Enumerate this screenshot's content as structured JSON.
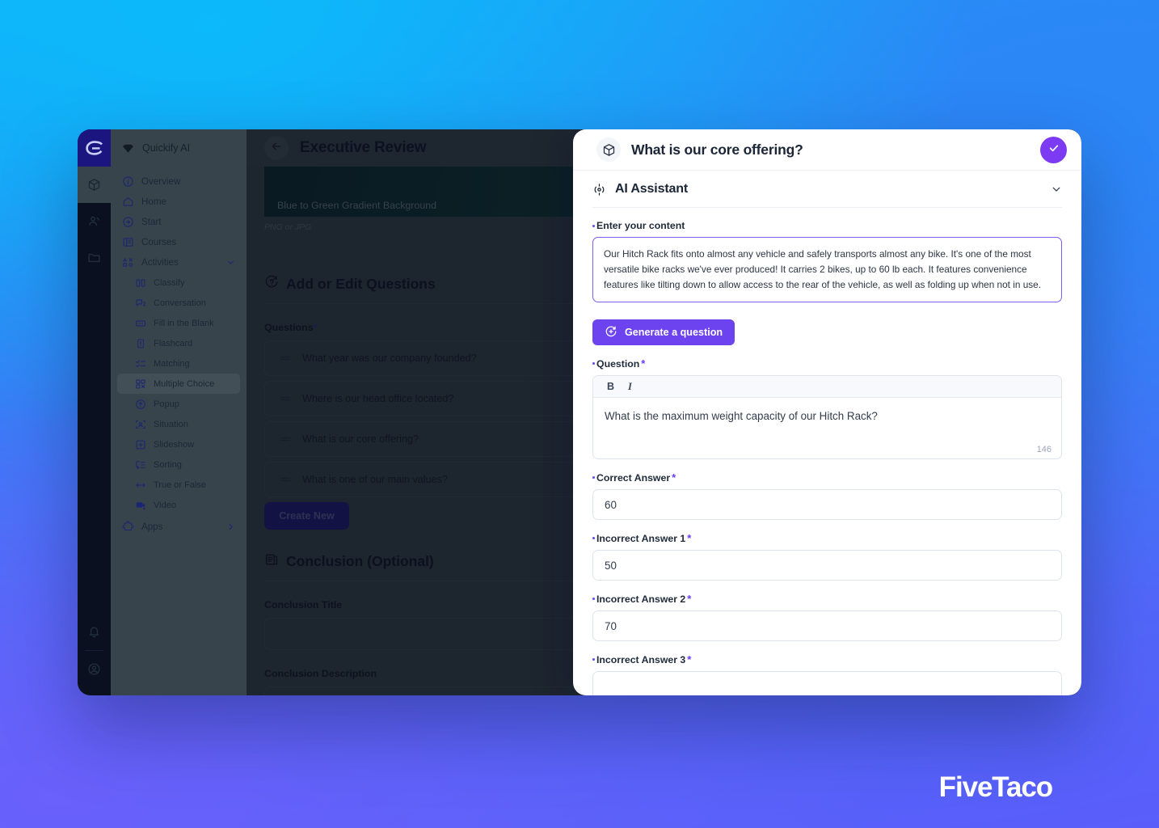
{
  "brand": {
    "footer_logo": "FiveTaco"
  },
  "colors": {
    "accent_purple": "#7c3bf2",
    "generate_button": "#6d42ef",
    "content_border": "#7c5cf5",
    "create_new_button": "#221a7a",
    "rail_logo_bg": "#1b1580"
  },
  "sidebar": {
    "brand_label": "Quickify AI",
    "rail_icons": [
      "cube-icon",
      "people-icon",
      "folder-icon",
      "bell-icon",
      "account-icon"
    ],
    "items": [
      {
        "label": "Overview",
        "icon": "info-circle-icon",
        "level": 0
      },
      {
        "label": "Home",
        "icon": "home-icon",
        "level": 0
      },
      {
        "label": "Start",
        "icon": "arrow-circle-right-icon",
        "level": 0
      },
      {
        "label": "Courses",
        "icon": "book-icon",
        "level": 0
      },
      {
        "label": "Activities",
        "icon": "activities-icon",
        "level": 0,
        "expanded": true,
        "chevron": "chevron-down-icon"
      },
      {
        "label": "Classify",
        "icon": "classify-icon",
        "level": 1
      },
      {
        "label": "Conversation",
        "icon": "conversation-icon",
        "level": 1
      },
      {
        "label": "Fill in the Blank",
        "icon": "fill-blank-icon",
        "level": 1
      },
      {
        "label": "Flashcard",
        "icon": "flashcard-icon",
        "level": 1
      },
      {
        "label": "Matching",
        "icon": "matching-icon",
        "level": 1
      },
      {
        "label": "Multiple Choice",
        "icon": "multiple-choice-icon",
        "level": 1,
        "active": true
      },
      {
        "label": "Popup",
        "icon": "popup-icon",
        "level": 1
      },
      {
        "label": "Situation",
        "icon": "situation-icon",
        "level": 1
      },
      {
        "label": "Slideshow",
        "icon": "slideshow-icon",
        "level": 1
      },
      {
        "label": "Sorting",
        "icon": "sorting-icon",
        "level": 1
      },
      {
        "label": "True or False",
        "icon": "true-false-icon",
        "level": 1
      },
      {
        "label": "Video",
        "icon": "video-icon",
        "level": 1
      },
      {
        "label": "Apps",
        "icon": "puzzle-icon",
        "level": 0,
        "chevron": "chevron-right-icon"
      }
    ]
  },
  "center": {
    "back_icon": "arrow-left-icon",
    "title": "Executive Review",
    "close_icon": "close-icon",
    "hero": {
      "label": "Blue to Green Gradient Background",
      "file_hint": "PNG or JPG"
    },
    "questions_section": {
      "heading": "Add or Edit Questions",
      "heading_icon": "question-refresh-icon",
      "field_label": "Questions",
      "required_mark": "*",
      "rows": [
        "What year was our company founded?",
        "Where is our head office located?",
        "What is our core offering?",
        "What is one of our main values?"
      ],
      "create_button": "Create New"
    },
    "conclusion_section": {
      "heading": "Conclusion (Optional)",
      "heading_icon": "document-icon",
      "title_label": "Conclusion Title",
      "title_value": "",
      "description_label": "Conclusion Description"
    }
  },
  "panel": {
    "header": {
      "icon": "cube-icon",
      "title": "What is our core offering?",
      "confirm_icon": "check-icon"
    },
    "ai_section": {
      "icon": "ai-sparkle-icon",
      "title": "AI Assistant",
      "collapse_icon": "chevron-down-icon"
    },
    "content_field": {
      "label": "Enter your content",
      "required_mark": "*",
      "value": "Our Hitch Rack fits onto almost any vehicle and safely transports almost any bike. It's one of the most versatile bike racks we've ever produced! It carries 2 bikes, up to 60 lb each. It features convenience features like tilting down to allow access to the rear of the vehicle, as well as folding up when not in use."
    },
    "generate_button": {
      "label": "Generate a question",
      "icon": "generate-icon"
    },
    "question_field": {
      "label": "Question",
      "required_mark": "*",
      "toolbar": {
        "bold": "B",
        "italic": "I"
      },
      "value": "What is the maximum weight capacity of our Hitch Rack?",
      "char_counter": "146"
    },
    "answers": [
      {
        "label": "Correct Answer",
        "required_mark": "*",
        "value": "60"
      },
      {
        "label": "Incorrect Answer 1",
        "required_mark": "*",
        "value": "50"
      },
      {
        "label": "Incorrect Answer 2",
        "required_mark": "*",
        "value": "70"
      },
      {
        "label": "Incorrect Answer 3",
        "required_mark": "*",
        "value": ""
      }
    ]
  }
}
